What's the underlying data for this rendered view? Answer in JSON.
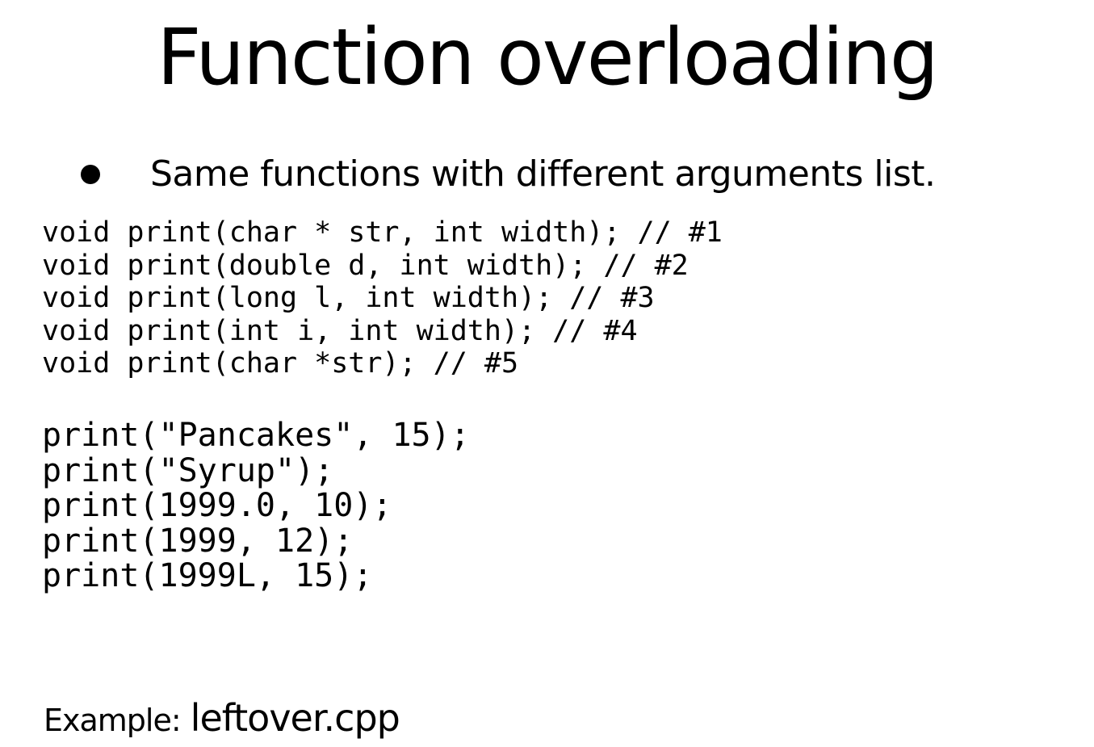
{
  "slide": {
    "title": "Function overloading",
    "bullet": "Same functions with different arguments list.",
    "declarations": [
      "void print(char * str, int width); // #1",
      "void print(double d, int width); // #2",
      "void print(long l, int width); // #3",
      "void print(int i, int width); // #4",
      "void print(char *str); // #5"
    ],
    "calls": [
      "print(\"Pancakes\", 15);",
      "print(\"Syrup\");",
      "print(1999.0, 10);",
      "print(1999, 12);",
      "print(1999L, 15);"
    ],
    "example_label": "Example:",
    "example_file": "leftover.cpp"
  }
}
